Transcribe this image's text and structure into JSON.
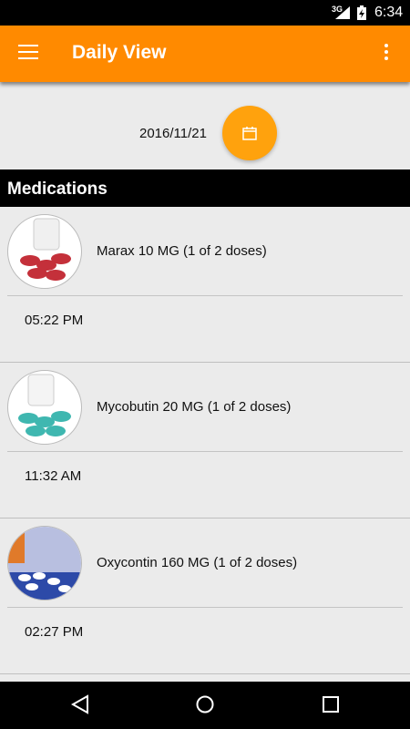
{
  "status_bar": {
    "network": "3G",
    "time": "6:34"
  },
  "app_bar": {
    "title": "Daily View"
  },
  "date_selector": {
    "date": "2016/11/21"
  },
  "section": {
    "title": "Medications"
  },
  "medications": [
    {
      "name": "Marax 10 MG (1 of 2 doses)",
      "time": "05:22 PM",
      "pill_color": "#c4303a"
    },
    {
      "name": "Mycobutin 20 MG (1 of 2 doses)",
      "time": "11:32 AM",
      "pill_color": "#3fb7b0"
    },
    {
      "name": "Oxycontin 160 MG (1 of 2 doses)",
      "time": "02:27 PM",
      "pill_color": "#3a55b5"
    }
  ],
  "colors": {
    "accent": "#ff8a00",
    "fab": "#ffa20d"
  }
}
